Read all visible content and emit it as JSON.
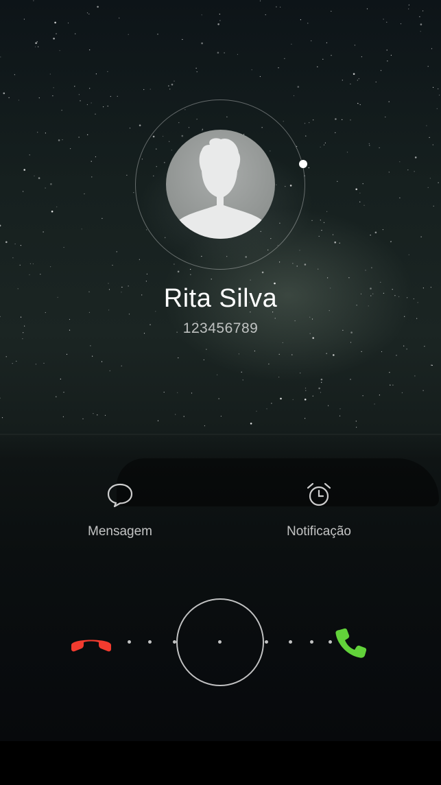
{
  "caller": {
    "name": "Rita Silva",
    "number": "123456789"
  },
  "actions": {
    "message_label": "Mensagem",
    "notification_label": "Notificação"
  },
  "icons": {
    "message": "chat-bubble-icon",
    "notification": "alarm-clock-icon",
    "decline": "phone-hangup-icon",
    "answer": "phone-answer-icon",
    "avatar": "person-silhouette-icon"
  },
  "colors": {
    "decline": "#f23b2f",
    "answer": "#62d23a"
  }
}
